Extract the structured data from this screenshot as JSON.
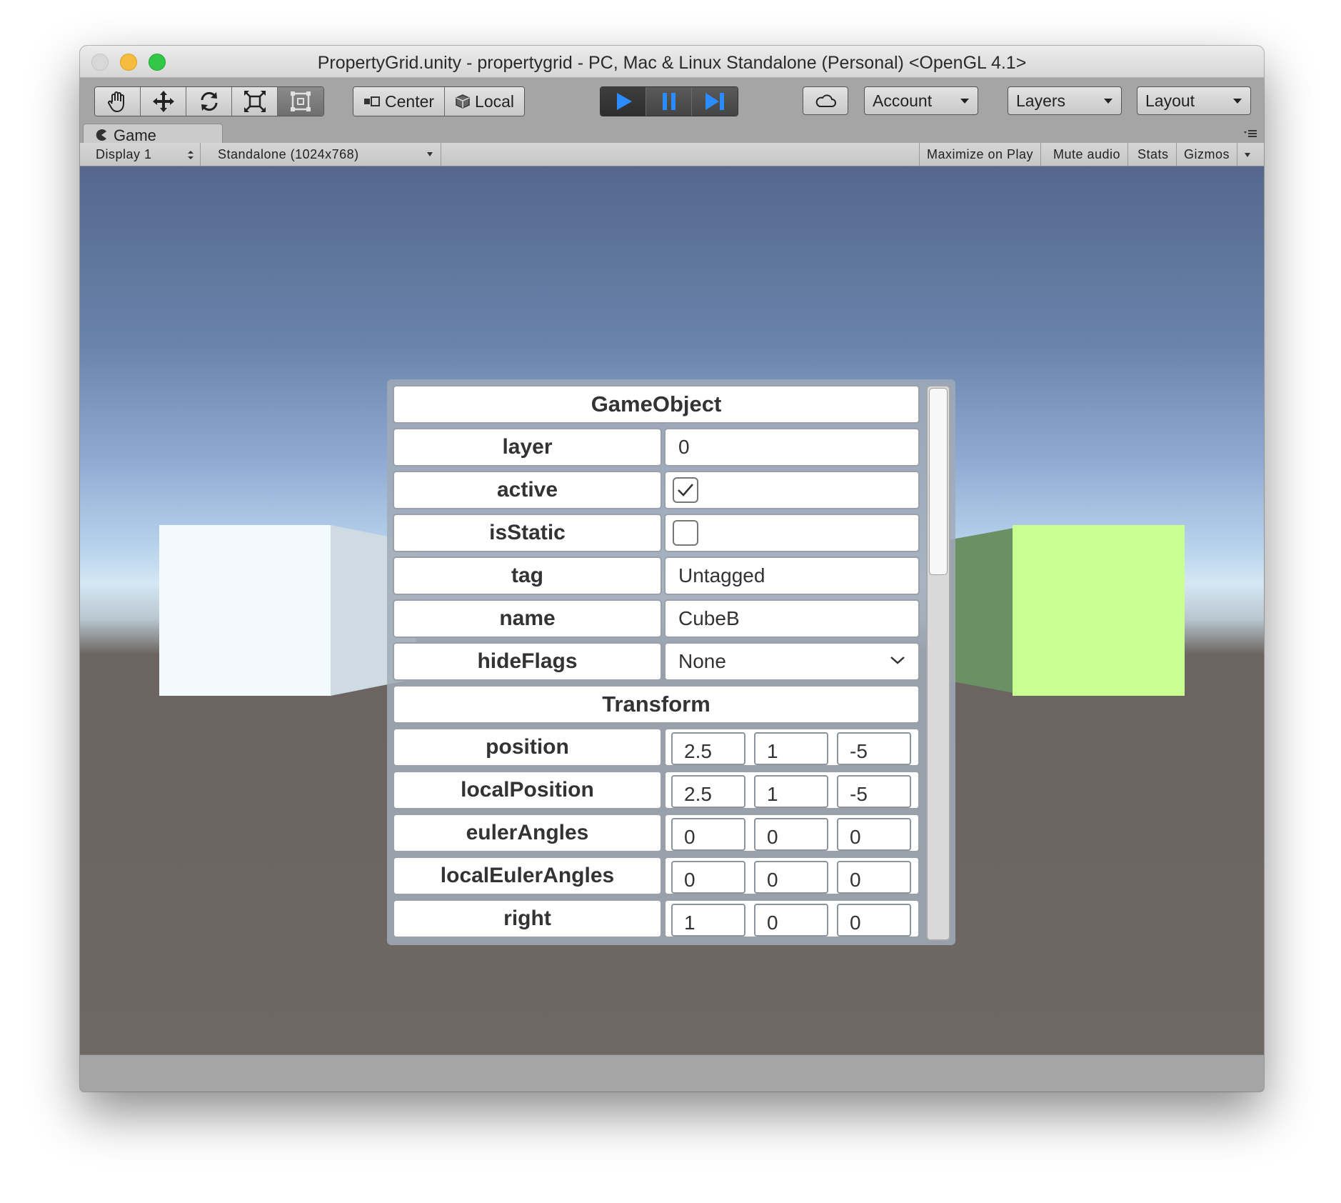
{
  "window": {
    "title": "PropertyGrid.unity - propertygrid - PC, Mac & Linux Standalone (Personal) <OpenGL 4.1>"
  },
  "toolbar": {
    "tools": [
      "hand-icon",
      "move-icon",
      "rotate-icon",
      "scale-icon",
      "rect-icon"
    ],
    "pivot_label": "Center",
    "space_label": "Local",
    "account_label": "Account",
    "layers_label": "Layers",
    "layout_label": "Layout"
  },
  "tab": {
    "label": "Game"
  },
  "gamebar": {
    "display": "Display 1",
    "resolution": "Standalone (1024x768)",
    "maximize": "Maximize on Play",
    "mute": "Mute audio",
    "stats": "Stats",
    "gizmos": "Gizmos"
  },
  "grid": {
    "sections": [
      "GameObject",
      "Transform"
    ],
    "layer": {
      "label": "layer",
      "value": "0"
    },
    "active": {
      "label": "active",
      "checked": true
    },
    "isStatic": {
      "label": "isStatic",
      "checked": false
    },
    "tag": {
      "label": "tag",
      "value": "Untagged"
    },
    "name": {
      "label": "name",
      "value": "CubeB"
    },
    "hideFlags": {
      "label": "hideFlags",
      "value": "None"
    },
    "position": {
      "label": "position",
      "x": "2.5",
      "y": "1",
      "z": "-5"
    },
    "localPosition": {
      "label": "localPosition",
      "x": "2.5",
      "y": "1",
      "z": "-5"
    },
    "eulerAngles": {
      "label": "eulerAngles",
      "x": "0",
      "y": "0",
      "z": "0"
    },
    "localEulerAngles": {
      "label": "localEulerAngles",
      "x": "0",
      "y": "0",
      "z": "0"
    },
    "right": {
      "label": "right",
      "x": "1",
      "y": "0",
      "z": "0"
    }
  },
  "colors": {
    "play_accent": "#2a8cff",
    "cube_left": "#f2fafd",
    "cube_right": "#caff92"
  }
}
